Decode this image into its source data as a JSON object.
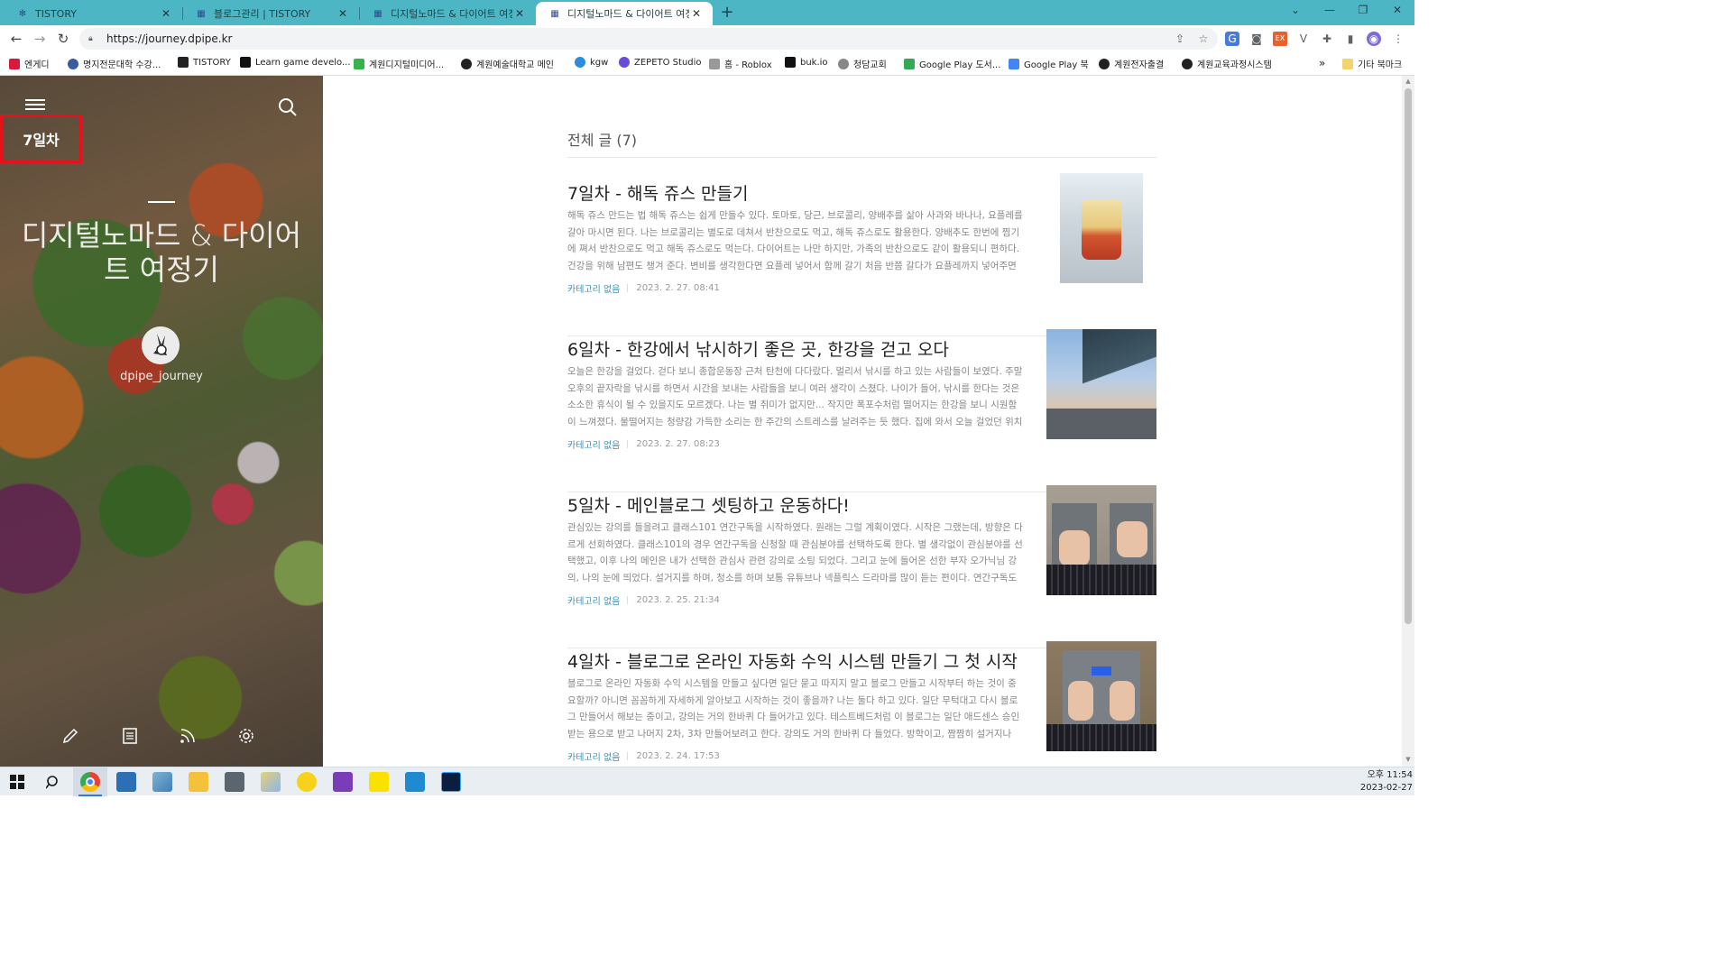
{
  "browser": {
    "tabs": [
      {
        "title": "TISTORY",
        "favicon": "tistory-icon",
        "active": false
      },
      {
        "title": "블로그관리 | TISTORY",
        "favicon": "tistory-manage-icon",
        "active": false
      },
      {
        "title": "디지털노마드 & 다이어트 여정기",
        "favicon": "blog-icon",
        "active": false
      },
      {
        "title": "디지털노마드 & 다이어트 여정기",
        "favicon": "blog-icon",
        "active": true
      }
    ],
    "url": "https://journey.dpipe.kr",
    "bookmarks": [
      {
        "label": "엔게디",
        "color": "#d81b3a"
      },
      {
        "label": "명지전문대학 수강...",
        "color": "#3a5ba0"
      },
      {
        "label": "TISTORY",
        "color": "#222222"
      },
      {
        "label": "Learn game develo...",
        "color": "#111111"
      },
      {
        "label": "계원디지털미디어...",
        "color": "#36b34a"
      },
      {
        "label": "계원예술대학교 메인",
        "color": "#222222"
      },
      {
        "label": "kgw",
        "color": "#2a8fd8"
      },
      {
        "label": "ZEPETO Studio",
        "color": "#6a4bd8"
      },
      {
        "label": "홈 - Roblox",
        "color": "#999999"
      },
      {
        "label": "buk.io",
        "color": "#111111"
      },
      {
        "label": "청담교회",
        "color": "#888888"
      },
      {
        "label": "Google Play 도서...",
        "color": "#34a853"
      },
      {
        "label": "Google Play 북",
        "color": "#4285f4"
      },
      {
        "label": "계원전자출결",
        "color": "#222222"
      },
      {
        "label": "계원교육과정시스템",
        "color": "#222222"
      }
    ],
    "more_bookmarks": "»",
    "other_bookmarks": "기타 북마크"
  },
  "sidebar": {
    "category_label": "7일차",
    "blog_title": "디지털노마드 & 다이어트 여정기",
    "owner": "dpipe_journey"
  },
  "main": {
    "list_heading": "전체 글 (7)",
    "posts": [
      {
        "title": "7일차 - 해독 쥬스 만들기",
        "excerpt": "해독 쥬스 만드는 법 해독 쥬스는 쉽게 만들수 있다. 토마토, 당근, 브로콜리, 양배추를 삶아 사과와 바나나, 요플레를 갈아 마시면 된다. 나는 브로콜리는 별도로 데쳐서 반찬으로도 먹고, 해독 쥬스로도 활용한다. 양배추도 한번에 찜기에 쪄서 반찬으로도 먹고 해독 쥬스로도 먹는다. 다이어트는 나만 하지만, 가족의 반찬으로도 같이 활용되니 편하다. 건강을 위해 남편도 챙겨 준다. 변비를 생각한다면 요플레 넣어서 함께 갈기 처음 반쯤 갈다가 요플레까지 넣어주면 쉽게 갈…",
        "category": "카테고리 없음",
        "date": "2023. 2. 27. 08:41"
      },
      {
        "title": "6일차 - 한강에서 낚시하기 좋은 곳, 한강을 걷고 오다",
        "excerpt": "오늘은 한강을 걸었다. 걷다 보니 종합운동장 근처 탄천에 다다랐다. 멀리서 낚시를 하고 있는 사람들이 보였다. 주말 오후의 끝자락을 낚시를 하면서 시간을 보내는 사람들을 보니 여러 생각이 스쳤다. 나이가 들어, 낚시를 한다는 것은 소소한 휴식이 될 수 있을지도 모르겠다. 나는 별 취미가 없지만... 작지만 폭포수처럼 떨어지는 한강을 보니 시원함이 느껴졌다. 물떨어지는 청량감 가득한 소리는 한 주간의 스트레스를 날려주는 듯 했다. 집에 와서 오늘 걸었던 위치를 확인…",
        "category": "카테고리 없음",
        "date": "2023. 2. 27. 08:23"
      },
      {
        "title": "5일차 - 메인블로그 셋팅하고 운동하다!",
        "excerpt": "관심있는 강의를 들을려고 클래스101 연간구독을 시작하였다. 원래는 그럴 계획이였다. 시작은 그랬는데, 방향은 다르게 선회하였다. 클래스101의 경우 연간구독을 신청할 때 관심분야를 선택하도록 한다. 별 생각없이 관심분야를 선택했고, 이후 나의 메인은 내가 선택한 관심사 관련 강의로 소팅 되었다. 그리고 눈에 들어온 선한 부자 오가닉님 강의, 나의 눈에 띄었다. 설거지를 하며, 청소를 하며 보통 유튜브나 넥플릭스 드라마를 많이 듣는 편이다. 연간구독도 신청했으…",
        "category": "카테고리 없음",
        "date": "2023. 2. 25. 21:34"
      },
      {
        "title": "4일차 - 블로그로 온라인 자동화 수익 시스템 만들기 그 첫 시작",
        "excerpt": "블로그로 온라인 자동화 수익 시스템을 만들고 싶다면 일단 묻고 따지지 말고 블로그 만들고 시작부터 하는 것이 중요할까? 아니면 꼼꼼하게 자세하게 알아보고 시작하는 것이 좋을까? 나는 둘다 하고 있다. 일단 무턱대고 다시 블로그 만들어서 해보는 중이고, 강의는 거의 한바퀴 다 들어가고 있다. 테스트베드처럼 이 블로그는 일단 애드센스 승인 받는 용으로 받고 나머지 2차, 3차 만들어보려고 한다. 강의도 거의 한바퀴 다 들었다. 방학이고, 짬짬히 설거지나 운동이나 …",
        "category": "카테고리 없음",
        "date": "2023. 2. 24. 17:53"
      }
    ]
  },
  "taskbar": {
    "time": "오후 11:54",
    "date": "2023-02-27"
  },
  "colors": {
    "tabstrip": "#4db6c4",
    "highlight_box": "#e8101b",
    "category_link": "#3a8fb7"
  }
}
